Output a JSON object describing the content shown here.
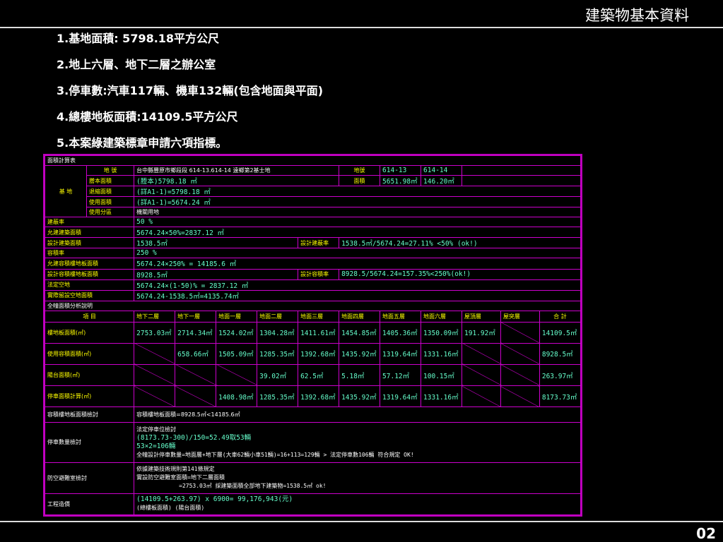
{
  "header": {
    "title": "建築物基本資料",
    "page_number": "02"
  },
  "bullets": [
    "1.基地面積: 5798.18平方公尺",
    "2.地上六層、地下二層之辦公室",
    "3.停車數:汽車117輛、機車132輛(包含地面與平面)",
    "4.總樓地板面積:14109.5平方公尺",
    "5.本案綠建築標章申請六項指標。"
  ],
  "cad": {
    "heading": "面積計算表",
    "site_label": "基 地",
    "location_label": "地 號",
    "location_value": "台中縣豐原市鄉段段 614-13.614-14 遠鄉第2基士地",
    "lot_label": "地號",
    "lot1": "614-13",
    "lot2": "614-14",
    "area_label": "面積",
    "area1": "5651.98㎡",
    "area2": "146.20㎡",
    "ledger_label": "謄本面積",
    "ledger_value": "(謄本)5798.18 ㎡",
    "reduced_label": "退縮面積",
    "reduced_value": "(詳A1-1)=5798.18 ㎡",
    "used_label": "使用面積",
    "used_value": "(詳A1-1)=5674.24 ㎡",
    "zone_label": "使用分區",
    "zone_value": "機關用地",
    "coverage_label": "建蔽率",
    "coverage_value": "50 %",
    "allow_cov_label": "允建建築面積",
    "allow_cov_value": "5674.24×50%=2837.12 ㎡",
    "design_cov_label": "設計建築面積",
    "design_cov_value": "1538.5㎡",
    "design_ratio_label": "設計建蔽率",
    "design_ratio_value": "1538.5㎡/5674.24=27.11% <50% (ok!)",
    "far_label": "容積率",
    "far_value": "250 %",
    "allow_far_label": "允建容積樓地板面積",
    "allow_far_value": "5674.24×250% = 14185.6 ㎡",
    "design_far_label": "設計容積樓地板面積",
    "design_far_value": "8928.5㎡",
    "design_far_ratio_label": "設計容積率",
    "design_far_ratio_value": "8928.5/5674.24=157.35%<250%(ok!)",
    "open_label": "法定空地",
    "open_value": "5674.24×(1-50)% = 2837.12 ㎡",
    "actual_open_label": "實際留設空地面積",
    "actual_open_value": "5674.24-1538.5㎡=4135.74㎡",
    "floor_heading": "全幢面積分析說明",
    "columns": [
      "項 目",
      "地下二層",
      "地下一層",
      "地面一層",
      "地面二層",
      "地面三層",
      "地面四層",
      "地面五層",
      "地面六層",
      "屋頂層",
      "屋突層",
      "合 計"
    ],
    "rows": [
      {
        "label": "樓地板面積(㎡)",
        "values": [
          "2753.03㎡",
          "2714.34㎡",
          "1524.02㎡",
          "1304.28㎡",
          "1411.61㎡",
          "1454.85㎡",
          "1405.36㎡",
          "1350.09㎡",
          "191.92㎡",
          "",
          "14109.5㎡"
        ]
      },
      {
        "label": "使用容積面積(㎡)",
        "values": [
          "",
          "658.66㎡",
          "1505.09㎡",
          "1285.35㎡",
          "1392.68㎡",
          "1435.92㎡",
          "1319.64㎡",
          "1331.16㎡",
          "",
          "",
          "8928.5㎡"
        ]
      },
      {
        "label": "陽台面積(㎡)",
        "values": [
          "",
          "",
          "",
          "39.02㎡",
          "62.5㎡",
          "5.18㎡",
          "57.12㎡",
          "100.15㎡",
          "",
          "",
          "263.97㎡"
        ]
      },
      {
        "label": "停車面積計算(㎡)",
        "values": [
          "",
          "",
          "1408.98㎡",
          "1285.35㎡",
          "1392.68㎡",
          "1435.92㎡",
          "1319.64㎡",
          "1331.16㎡",
          "",
          "",
          "8173.73㎡"
        ]
      }
    ],
    "check1_label": "容積樓地板面積檢討",
    "check1_value": "容積樓地板面積=8928.5㎡<14185.6㎡",
    "check2_label": "停車數量檢討",
    "check2_lines": [
      "法定停車位檢討",
      "(8173.73-300)/150=52.49取53輛",
      "53×2=106輛",
      "全幢設計停車數量=地面層+地下層(大車62輛小車51輛)=16+113=129輛 > 法定停車數106輛 符合規定 OK!"
    ],
    "check3_label": "防空避難室檢討",
    "check3_lines": [
      "依據建築技術規則第141條規定",
      "實設防空避難室面積=地下二層面積",
      "=2753.03㎡ 採建築面積全部地下建築物=1538.5㎡ ok!"
    ],
    "check4_label": "工程造價",
    "check4_lines": [
      "(14109.5+263.97) x 6900= 99,176,943(元)",
      "(總樓板面積) (陽台面積)"
    ]
  }
}
